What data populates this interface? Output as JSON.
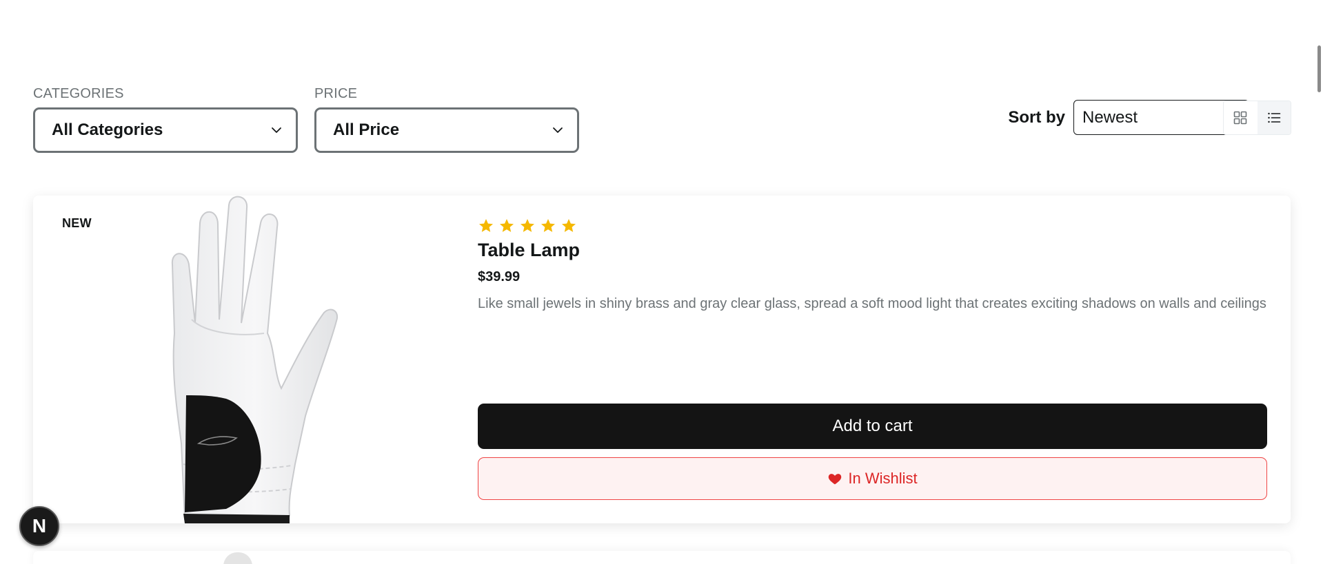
{
  "filters": {
    "categories": {
      "label": "CATEGORIES",
      "value": "All Categories"
    },
    "price": {
      "label": "PRICE",
      "value": "All Price"
    }
  },
  "sort": {
    "label": "Sort by",
    "value": "Newest"
  },
  "view": {
    "active": "list",
    "options": [
      "grid",
      "list"
    ]
  },
  "product": {
    "badge": "NEW",
    "rating": 5,
    "title": "Table Lamp",
    "price": "$39.99",
    "description": "Like small jewels in shiny brass and gray clear glass, spread a soft mood light that creates exciting shadows on walls and ceilings",
    "add_to_cart": "Add to cart",
    "wishlist": "In Wishlist",
    "image": "white-golf-glove"
  },
  "dev_badge": {
    "letter": "N"
  },
  "colors": {
    "star": "#f5b800",
    "primary": "#141414",
    "wishlist": "#dc2626",
    "wishlist_bg": "#fef2f2"
  }
}
